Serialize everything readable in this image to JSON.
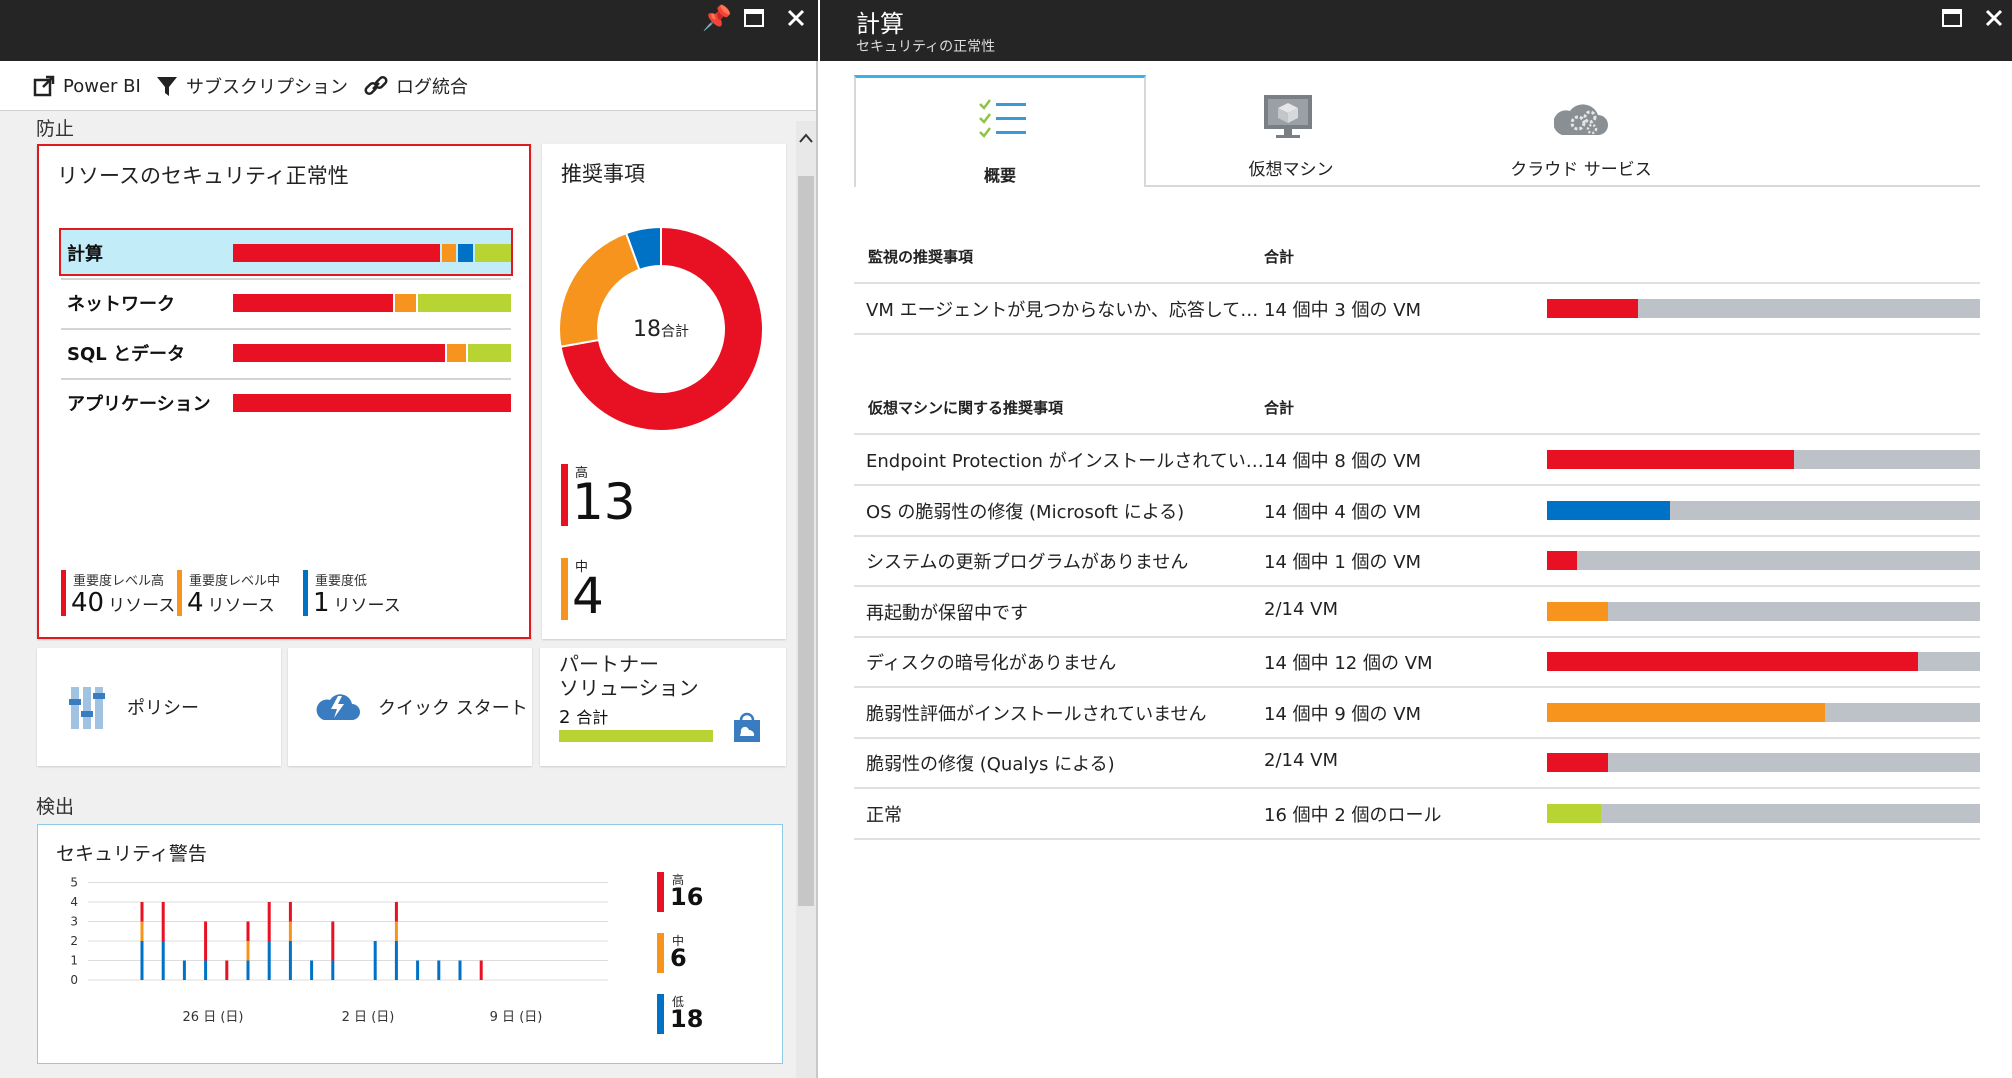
{
  "left": {
    "toolbar": {
      "powerbi_label": "Power BI",
      "subscription_label": "サブスクリプション",
      "log_label": "ログ統合"
    },
    "prevention_label": "防止",
    "detection_label": "検出",
    "resource_health": {
      "title": "リソースのセキュリティ正常性",
      "rows": [
        {
          "label": "計算",
          "high": 0.745,
          "medium": 0.06,
          "low": 0.06,
          "healthy": 0.135
        },
        {
          "label": "ネットワーク",
          "high": 0.58,
          "medium": 0.08,
          "low": 0,
          "healthy": 0.34
        },
        {
          "label": "SQL とデータ",
          "high": 0.765,
          "medium": 0.075,
          "low": 0,
          "healthy": 0.16
        },
        {
          "label": "アプリケーション",
          "high": 1,
          "medium": 0,
          "low": 0,
          "healthy": 0
        }
      ],
      "legend": [
        {
          "label": "重要度レベル高",
          "value": "40",
          "unit": "リソース",
          "color": "#e81123"
        },
        {
          "label": "重要度レベル中",
          "value": "4",
          "unit": "リソース",
          "color": "#f7941d"
        },
        {
          "label": "重要度低",
          "value": "1",
          "unit": "リソース",
          "color": "#0072c6"
        }
      ]
    },
    "recommendations": {
      "title": "推奨事項",
      "total_value": "18",
      "total_unit": "合計",
      "donut": {
        "high": 13,
        "medium": 4,
        "low": 1
      },
      "high_label": "高",
      "high_value": "13",
      "medium_label": "中",
      "medium_value": "4"
    },
    "policy_label": "ポリシー",
    "quickstart_label": "クイック スタート",
    "partner": {
      "title_line1": "パートナー",
      "title_line2": "ソリューション",
      "count": "2",
      "count_unit": "合計"
    },
    "alerts": {
      "title": "セキュリティ警告",
      "high_label": "高",
      "high_value": "16",
      "medium_label": "中",
      "medium_value": "6",
      "low_label": "低",
      "low_value": "18"
    }
  },
  "right": {
    "title": "計算",
    "subtitle": "セキュリティの正常性",
    "tabs": [
      {
        "label": "概要"
      },
      {
        "label": "仮想マシン"
      },
      {
        "label": "クラウド サービス"
      }
    ],
    "monitoring": {
      "header_name": "監視の推奨事項",
      "header_total": "合計",
      "rows": [
        {
          "name": "VM エージェントが見つからないか、応答して…",
          "total": "14 個中 3 個の VM",
          "fraction": 0.21,
          "color": "#e81123"
        }
      ]
    },
    "vm": {
      "header_name": "仮想マシンに関する推奨事項",
      "header_total": "合計",
      "rows": [
        {
          "name": "Endpoint Protection がインストールされてい…",
          "total": "14 個中 8 個の VM",
          "fraction": 0.57,
          "color": "#e81123"
        },
        {
          "name": "OS の脆弱性の修復 (Microsoft による)",
          "total": "14 個中 4 個の VM",
          "fraction": 0.285,
          "color": "#0072c6"
        },
        {
          "name": "システムの更新プログラムがありません",
          "total": "14 個中 1 個の VM",
          "fraction": 0.07,
          "color": "#e81123"
        },
        {
          "name": "再起動が保留中です",
          "total": "2/14 VM",
          "fraction": 0.14,
          "color": "#f7941d"
        },
        {
          "name": "ディスクの暗号化がありません",
          "total": "14 個中 12 個の VM",
          "fraction": 0.857,
          "color": "#e81123"
        },
        {
          "name": "脆弱性評価がインストールされていません",
          "total": "14 個中 9 個の VM",
          "fraction": 0.643,
          "color": "#f7941d"
        },
        {
          "name": "脆弱性の修復 (Qualys による)",
          "total": "2/14 VM",
          "fraction": 0.14,
          "color": "#e81123"
        },
        {
          "name": "正常",
          "total": "16 個中 2 個のロール",
          "fraction": 0.125,
          "color": "#b8d432"
        }
      ]
    }
  },
  "chart_data": {
    "type": "bar",
    "title": "セキュリティ警告",
    "y_ticks": [
      "0",
      "1",
      "2",
      "3",
      "4",
      "5"
    ],
    "ylim": [
      0,
      5
    ],
    "x_tick_labels": [
      "26 日 (日)",
      "2 日 (日)",
      "9 日 (日)"
    ],
    "series": [
      {
        "name": "低",
        "color": "#0072c6",
        "values": [
          2,
          2,
          1,
          1,
          0,
          1,
          2,
          2,
          1,
          1,
          0,
          2,
          2,
          1,
          1,
          1,
          0
        ]
      },
      {
        "name": "中",
        "color": "#f7941d",
        "values": [
          1,
          0,
          0,
          0,
          0,
          1,
          0,
          1,
          0,
          0,
          0,
          0,
          1,
          0,
          0,
          0,
          0
        ]
      },
      {
        "name": "高",
        "color": "#e81123",
        "values": [
          1,
          2,
          0,
          2,
          1,
          1,
          2,
          1,
          0,
          2,
          0,
          0,
          1,
          0,
          0,
          0,
          1
        ]
      }
    ],
    "legend_position": "right"
  }
}
